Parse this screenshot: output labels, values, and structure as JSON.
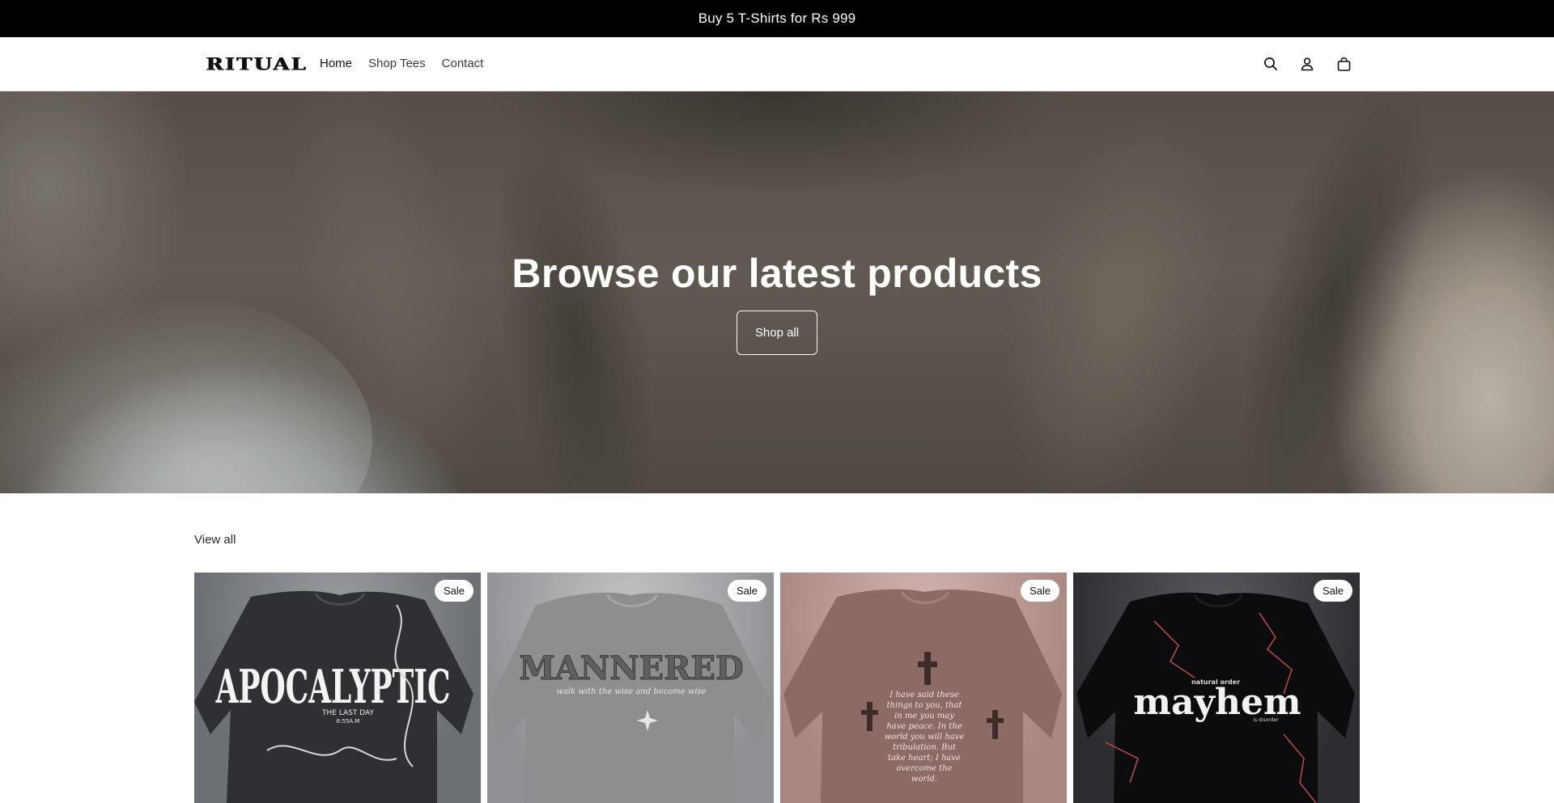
{
  "announcement": {
    "text": "Buy 5 T-Shirts for Rs 999"
  },
  "header": {
    "logo_text": "RITUAL",
    "nav": [
      {
        "label": "Home"
      },
      {
        "label": "Shop Tees"
      },
      {
        "label": "Contact"
      }
    ],
    "icons": [
      "search-icon",
      "account-icon",
      "cart-icon"
    ]
  },
  "hero": {
    "title": "Browse our latest products",
    "button_label": "Shop all"
  },
  "collection": {
    "view_all_label": "View all",
    "products": [
      {
        "badge": "Sale",
        "print": "APOCALYPTIC",
        "print_sub": "THE LAST DAY",
        "print_sub2": "6:55A.M",
        "shirt_color": "#2f3033",
        "bg_color": "#7c7f83"
      },
      {
        "badge": "Sale",
        "print": "MANNERED",
        "print_sub": "walk with the wise and become wise",
        "shirt_color": "#8d8e90",
        "bg_color": "#a7a9ab"
      },
      {
        "badge": "Sale",
        "print": "I have said these things to you, that in me you may have peace. In the world you will have tribulation. But take heart; I have overcome the world.",
        "shirt_color": "#8c6a66",
        "bg_color": "#b28e8a"
      },
      {
        "badge": "Sale",
        "print": "mayhem",
        "print_sub": "natural order",
        "print_sub2": "is disorder",
        "shirt_color": "#0c0c0e",
        "bg_color": "#3c3d41"
      }
    ]
  }
}
